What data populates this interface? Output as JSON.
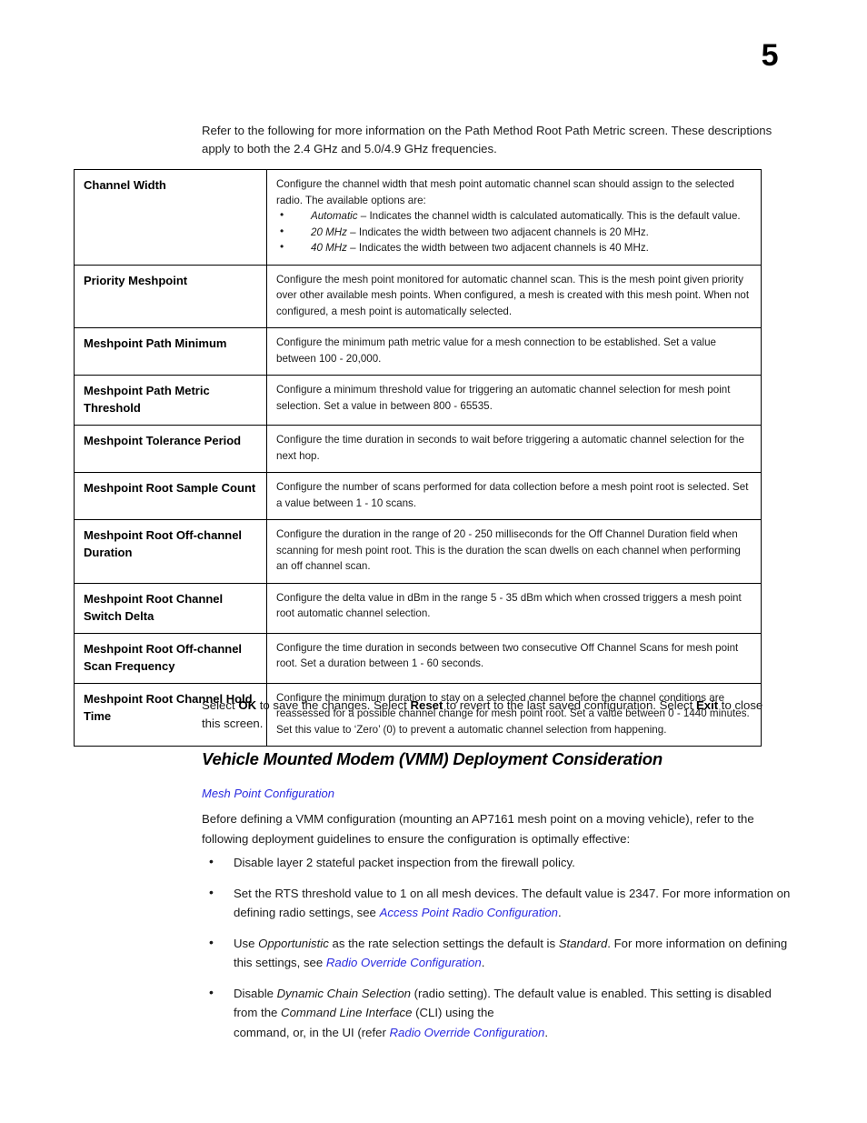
{
  "page": {
    "number": "5"
  },
  "intro": {
    "text": "Refer to the following for more information on the Path Method Root Path Metric screen. These descriptions apply to both the 2.4 GHz and 5.0/4.9 GHz frequencies."
  },
  "table": {
    "rows": [
      {
        "term": "Channel Width",
        "desc_lead": "Configure the channel width that mesh point automatic channel scan should assign to the selected radio. The available options are:",
        "options": [
          {
            "label": "Automatic",
            "dash": " – ",
            "text": "Indicates the channel width is calculated automatically. This is the default value."
          },
          {
            "label": "20 MHz",
            "dash": " – ",
            "text": "Indicates the width between two adjacent channels is 20 MHz."
          },
          {
            "label": "40 MHz",
            "dash": " – ",
            "text": "Indicates the width between two adjacent channels is 40 MHz."
          }
        ]
      },
      {
        "term": "Priority Meshpoint",
        "desc_lead": "Configure the mesh point monitored for automatic channel scan. This is the mesh point given priority over other available mesh points. When configured, a mesh is created with this mesh point. When not configured, a mesh point is automatically selected.",
        "options": []
      },
      {
        "term": "Meshpoint Path Minimum",
        "desc_lead": "Configure the minimum path metric value for a mesh connection to be established. Set a value between 100 - 20,000.",
        "options": []
      },
      {
        "term": "Meshpoint Path Metric Threshold",
        "desc_lead": "Configure a minimum threshold value for triggering an automatic channel selection for mesh point selection. Set a value in between 800 - 65535.",
        "options": []
      },
      {
        "term": "Meshpoint Tolerance Period",
        "desc_lead": "Configure the time duration in seconds to wait before triggering a automatic channel selection for the next hop.",
        "options": []
      },
      {
        "term": "Meshpoint Root Sample Count",
        "desc_lead": "Configure the number of scans performed for data collection before a mesh point root is selected. Set a value between 1 - 10 scans.",
        "options": []
      },
      {
        "term": "Meshpoint Root Off-channel Duration",
        "desc_lead": "Configure the duration in the range of 20 - 250 milliseconds for the Off Channel Duration field when scanning for mesh point root. This is the duration the scan dwells on each channel when performing an off channel scan.",
        "options": []
      },
      {
        "term": "Meshpoint Root Channel Switch Delta",
        "desc_lead": "Configure the delta value in dBm in the range 5 - 35 dBm which when crossed triggers a mesh point root automatic channel selection.",
        "options": []
      },
      {
        "term": "Meshpoint Root Off-channel Scan Frequency",
        "desc_lead": "Configure the time duration in seconds between two consecutive Off Channel Scans for mesh point root. Set a duration between 1 - 60 seconds.",
        "options": []
      },
      {
        "term": "Meshpoint Root Channel Hold Time",
        "desc_lead": "Configure the minimum duration to stay on a selected channel before the channel conditions are reassessed for a possible channel change for mesh point root. Set a value between 0 - 1440 minutes. Set this value to ‘Zero’ (0) to prevent a automatic channel selection from happening.",
        "options": []
      }
    ]
  },
  "select_note": {
    "part1": "Select ",
    "ok": "OK",
    "part2": " to save the changes. Select ",
    "reset": "Reset",
    "part3": " to revert to the last saved configuration. Select ",
    "exit": "Exit",
    "part4": " to close this screen."
  },
  "section": {
    "heading": "Vehicle Mounted Modem (VMM) Deployment Consideration",
    "xref_link": "Mesh Point Configuration",
    "intro": "Before defining a VMM configuration (mounting an AP7161 mesh point on a moving vehicle), refer to the following deployment guidelines to ensure the configuration is optimally effective:"
  },
  "guidelines": [
    {
      "segments": [
        {
          "text": "Disable layer 2 stateful packet inspection from the firewall policy.",
          "style": "plain"
        }
      ]
    },
    {
      "segments": [
        {
          "text": "Set the RTS threshold value to 1 on all mesh devices. The default value is 2347. For more information on defining radio settings, see ",
          "style": "plain"
        },
        {
          "text": "Access Point Radio Configuration",
          "style": "link"
        },
        {
          "text": ".",
          "style": "plain"
        }
      ]
    },
    {
      "segments": [
        {
          "text": "Use ",
          "style": "plain"
        },
        {
          "text": "Opportunistic",
          "style": "italic"
        },
        {
          "text": " as the rate selection settings the default is ",
          "style": "plain"
        },
        {
          "text": "Standard",
          "style": "italic"
        },
        {
          "text": ". For more information on defining this settings, see ",
          "style": "plain"
        },
        {
          "text": "Radio Override Configuration",
          "style": "link"
        },
        {
          "text": ".",
          "style": "plain"
        }
      ]
    },
    {
      "segments": [
        {
          "text": "Disable ",
          "style": "plain"
        },
        {
          "text": "Dynamic Chain Selection",
          "style": "italic"
        },
        {
          "text": " (radio setting). The default value is enabled. This setting is disabled from the ",
          "style": "plain"
        },
        {
          "text": "Command Line Interface",
          "style": "italic"
        },
        {
          "text": " (CLI) using the",
          "style": "plain"
        },
        {
          "text": "BREAK",
          "style": "break"
        },
        {
          "text": "command, or, in the UI (refer ",
          "style": "plain"
        },
        {
          "text": "Radio Override Configuration",
          "style": "link"
        },
        {
          "text": ".",
          "style": "plain"
        }
      ]
    }
  ],
  "colors": {
    "link": "#2a2ae0",
    "text": "#1a1a1a",
    "border": "#000000"
  }
}
